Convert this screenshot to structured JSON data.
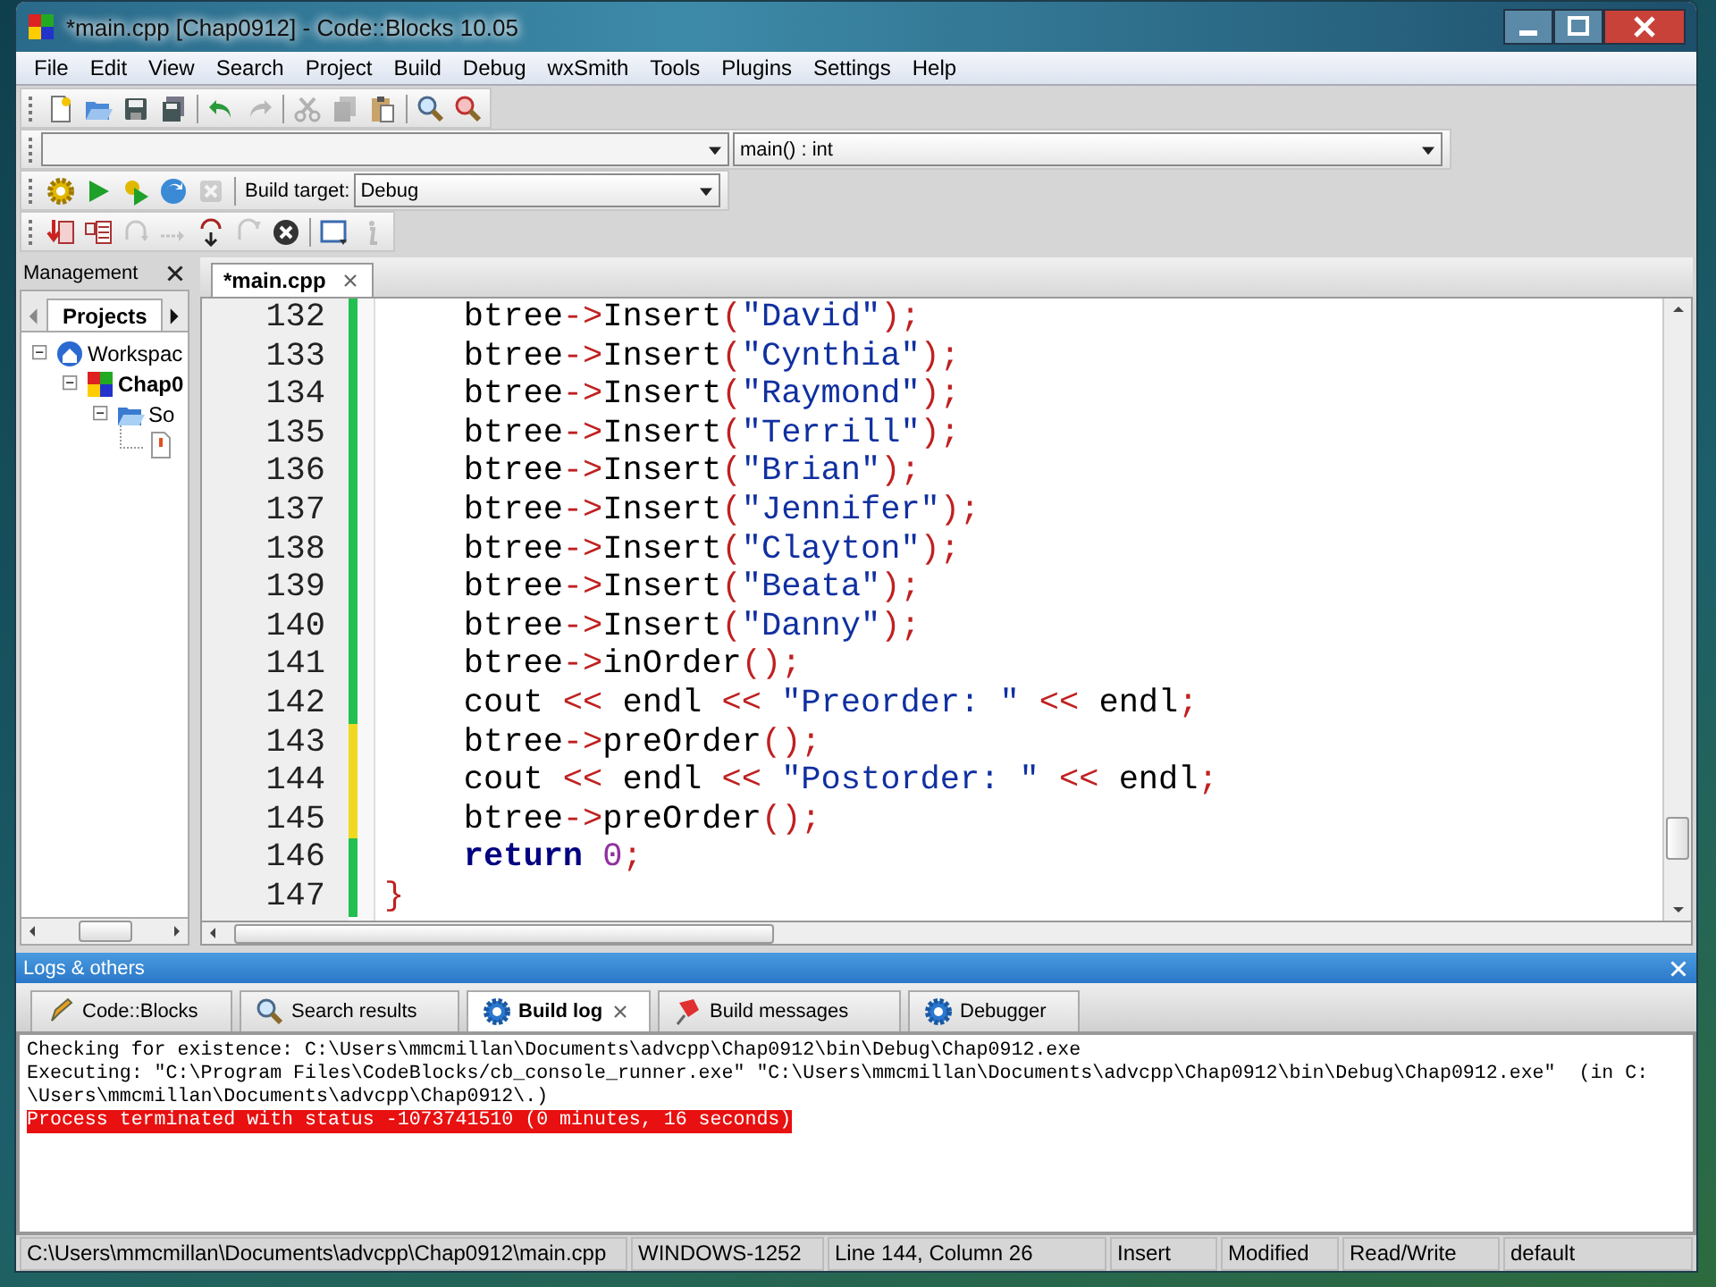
{
  "window": {
    "title": "*main.cpp [Chap0912] - Code::Blocks 10.05"
  },
  "menu": [
    "File",
    "Edit",
    "View",
    "Search",
    "Project",
    "Build",
    "Debug",
    "wxSmith",
    "Tools",
    "Plugins",
    "Settings",
    "Help"
  ],
  "toolbars": [
    {
      "buttons": [
        {
          "kind": "new",
          "disabled": false
        },
        {
          "kind": "open",
          "disabled": false
        },
        {
          "kind": "save",
          "disabled": false
        },
        {
          "kind": "saveall",
          "disabled": false
        },
        {
          "kind": "sep"
        },
        {
          "kind": "undo",
          "disabled": false
        },
        {
          "kind": "redo",
          "disabled": true
        },
        {
          "kind": "sep"
        },
        {
          "kind": "cut",
          "disabled": true
        },
        {
          "kind": "copy",
          "disabled": true
        },
        {
          "kind": "paste",
          "disabled": false
        },
        {
          "kind": "sep"
        },
        {
          "kind": "find",
          "disabled": false
        },
        {
          "kind": "replace",
          "disabled": false
        }
      ]
    },
    {
      "buttons": [
        {
          "kind": "build",
          "disabled": false
        },
        {
          "kind": "run",
          "disabled": false
        },
        {
          "kind": "buildrun",
          "disabled": false
        },
        {
          "kind": "rebuild",
          "disabled": false
        },
        {
          "kind": "abort",
          "disabled": true
        }
      ]
    },
    {
      "buttons": [
        {
          "kind": "debug",
          "disabled": false
        },
        {
          "kind": "cursor",
          "disabled": false
        },
        {
          "kind": "nextline",
          "disabled": true
        },
        {
          "kind": "nextinstr",
          "disabled": true
        },
        {
          "kind": "stepinto",
          "disabled": false
        },
        {
          "kind": "stepout",
          "disabled": true
        },
        {
          "kind": "stop",
          "disabled": false
        },
        {
          "kind": "sep"
        },
        {
          "kind": "window",
          "disabled": false
        },
        {
          "kind": "info",
          "disabled": true
        }
      ]
    }
  ],
  "function_combo": {
    "value": "main() : int"
  },
  "build_target": {
    "label": "Build target:",
    "value": "Debug"
  },
  "management": {
    "title": "Management",
    "tabs": [
      {
        "label": "Projects",
        "selected": true
      }
    ],
    "tree": [
      {
        "label": "Workspac",
        "kind": "workspace",
        "expanded": true,
        "active": false,
        "children": [
          {
            "label": "Chap0",
            "kind": "project",
            "expanded": true,
            "active": true,
            "children": [
              {
                "label": "So",
                "kind": "folder",
                "expanded": true,
                "active": false,
                "children": [
                  {
                    "kind": "file",
                    "active": false
                  }
                ]
              }
            ]
          }
        ]
      }
    ]
  },
  "editor": {
    "tabs": [
      {
        "label": "*main.cpp",
        "selected": true
      }
    ],
    "lines": [
      {
        "number": "132",
        "saved": true,
        "tokens": [
          {
            "kind": "id",
            "text": "    btree"
          },
          {
            "kind": "op",
            "text": "->"
          },
          {
            "kind": "id",
            "text": "Insert"
          },
          {
            "kind": "op",
            "text": "("
          },
          {
            "kind": "str",
            "text": "\"David\""
          },
          {
            "kind": "op",
            "text": ");"
          }
        ]
      },
      {
        "number": "133",
        "saved": true,
        "tokens": [
          {
            "kind": "id",
            "text": "    btree"
          },
          {
            "kind": "op",
            "text": "->"
          },
          {
            "kind": "id",
            "text": "Insert"
          },
          {
            "kind": "op",
            "text": "("
          },
          {
            "kind": "str",
            "text": "\"Cynthia\""
          },
          {
            "kind": "op",
            "text": ");"
          }
        ]
      },
      {
        "number": "134",
        "saved": true,
        "tokens": [
          {
            "kind": "id",
            "text": "    btree"
          },
          {
            "kind": "op",
            "text": "->"
          },
          {
            "kind": "id",
            "text": "Insert"
          },
          {
            "kind": "op",
            "text": "("
          },
          {
            "kind": "str",
            "text": "\"Raymond\""
          },
          {
            "kind": "op",
            "text": ");"
          }
        ]
      },
      {
        "number": "135",
        "saved": true,
        "tokens": [
          {
            "kind": "id",
            "text": "    btree"
          },
          {
            "kind": "op",
            "text": "->"
          },
          {
            "kind": "id",
            "text": "Insert"
          },
          {
            "kind": "op",
            "text": "("
          },
          {
            "kind": "str",
            "text": "\"Terrill\""
          },
          {
            "kind": "op",
            "text": ");"
          }
        ]
      },
      {
        "number": "136",
        "saved": true,
        "tokens": [
          {
            "kind": "id",
            "text": "    btree"
          },
          {
            "kind": "op",
            "text": "->"
          },
          {
            "kind": "id",
            "text": "Insert"
          },
          {
            "kind": "op",
            "text": "("
          },
          {
            "kind": "str",
            "text": "\"Brian\""
          },
          {
            "kind": "op",
            "text": ");"
          }
        ]
      },
      {
        "number": "137",
        "saved": true,
        "tokens": [
          {
            "kind": "id",
            "text": "    btree"
          },
          {
            "kind": "op",
            "text": "->"
          },
          {
            "kind": "id",
            "text": "Insert"
          },
          {
            "kind": "op",
            "text": "("
          },
          {
            "kind": "str",
            "text": "\"Jennifer\""
          },
          {
            "kind": "op",
            "text": ");"
          }
        ]
      },
      {
        "number": "138",
        "saved": true,
        "tokens": [
          {
            "kind": "id",
            "text": "    btree"
          },
          {
            "kind": "op",
            "text": "->"
          },
          {
            "kind": "id",
            "text": "Insert"
          },
          {
            "kind": "op",
            "text": "("
          },
          {
            "kind": "str",
            "text": "\"Clayton\""
          },
          {
            "kind": "op",
            "text": ");"
          }
        ]
      },
      {
        "number": "139",
        "saved": true,
        "tokens": [
          {
            "kind": "id",
            "text": "    btree"
          },
          {
            "kind": "op",
            "text": "->"
          },
          {
            "kind": "id",
            "text": "Insert"
          },
          {
            "kind": "op",
            "text": "("
          },
          {
            "kind": "str",
            "text": "\"Beata\""
          },
          {
            "kind": "op",
            "text": ");"
          }
        ]
      },
      {
        "number": "140",
        "saved": true,
        "tokens": [
          {
            "kind": "id",
            "text": "    btree"
          },
          {
            "kind": "op",
            "text": "->"
          },
          {
            "kind": "id",
            "text": "Insert"
          },
          {
            "kind": "op",
            "text": "("
          },
          {
            "kind": "str",
            "text": "\"Danny\""
          },
          {
            "kind": "op",
            "text": ");"
          }
        ]
      },
      {
        "number": "141",
        "saved": true,
        "tokens": [
          {
            "kind": "id",
            "text": "    btree"
          },
          {
            "kind": "op",
            "text": "->"
          },
          {
            "kind": "id",
            "text": "inOrder"
          },
          {
            "kind": "op",
            "text": "();"
          }
        ]
      },
      {
        "number": "142",
        "saved": true,
        "tokens": [
          {
            "kind": "id",
            "text": "    cout "
          },
          {
            "kind": "op",
            "text": "<<"
          },
          {
            "kind": "id",
            "text": " endl "
          },
          {
            "kind": "op",
            "text": "<< "
          },
          {
            "kind": "str",
            "text": "\"Preorder: \""
          },
          {
            "kind": "op",
            "text": " <<"
          },
          {
            "kind": "id",
            "text": " endl"
          },
          {
            "kind": "op",
            "text": ";"
          }
        ]
      },
      {
        "number": "143",
        "saved": false,
        "tokens": [
          {
            "kind": "id",
            "text": "    btree"
          },
          {
            "kind": "op",
            "text": "->"
          },
          {
            "kind": "id",
            "text": "preOrder"
          },
          {
            "kind": "op",
            "text": "();"
          }
        ]
      },
      {
        "number": "144",
        "saved": false,
        "tokens": [
          {
            "kind": "id",
            "text": "    cout "
          },
          {
            "kind": "op",
            "text": "<<"
          },
          {
            "kind": "id",
            "text": " endl "
          },
          {
            "kind": "op",
            "text": "<< "
          },
          {
            "kind": "str",
            "text": "\"Postorder: \""
          },
          {
            "kind": "op",
            "text": " <<"
          },
          {
            "kind": "id",
            "text": " endl"
          },
          {
            "kind": "op",
            "text": ";"
          }
        ]
      },
      {
        "number": "145",
        "saved": false,
        "tokens": [
          {
            "kind": "id",
            "text": "    btree"
          },
          {
            "kind": "op",
            "text": "->"
          },
          {
            "kind": "id",
            "text": "preOrder"
          },
          {
            "kind": "op",
            "text": "();"
          }
        ]
      },
      {
        "number": "146",
        "saved": true,
        "tokens": [
          {
            "kind": "kw",
            "text": "    return"
          },
          {
            "kind": "num",
            "text": " 0"
          },
          {
            "kind": "op",
            "text": ";"
          }
        ]
      },
      {
        "number": "147",
        "saved": true,
        "tokens": [
          {
            "kind": "op",
            "text": "}"
          }
        ]
      }
    ]
  },
  "logs": {
    "title": "Logs & others",
    "tabs": [
      {
        "label": "Code::Blocks",
        "kind": "pencil",
        "selected": false
      },
      {
        "label": "Search results",
        "kind": "search",
        "selected": false
      },
      {
        "label": "Build log",
        "kind": "gear",
        "selected": true
      },
      {
        "label": "Build messages",
        "kind": "pin",
        "selected": false
      },
      {
        "label": "Debugger",
        "kind": "gear",
        "selected": false
      }
    ],
    "lines": [
      {
        "kind": "info",
        "text": "Checking for existence: C:\\Users\\mmcmillan\\Documents\\advcpp\\Chap0912\\bin\\Debug\\Chap0912.exe"
      },
      {
        "kind": "info",
        "text": "Executing: \"C:\\Program Files\\CodeBlocks/cb_console_runner.exe\" \"C:\\Users\\mmcmillan\\Documents\\advcpp\\Chap0912\\bin\\Debug\\Chap0912.exe\"  (in C:"
      },
      {
        "kind": "info",
        "text": "\\Users\\mmcmillan\\Documents\\advcpp\\Chap0912\\.)"
      },
      {
        "kind": "error",
        "text": "Process terminated with status -1073741510 (0 minutes, 16 seconds)"
      }
    ]
  },
  "status_bar": [
    "C:\\Users\\mmcmillan\\Documents\\advcpp\\Chap0912\\main.cpp",
    "WINDOWS-1252",
    "Line 144, Column 26",
    "Insert",
    "Modified",
    "Read/Write",
    "default"
  ]
}
